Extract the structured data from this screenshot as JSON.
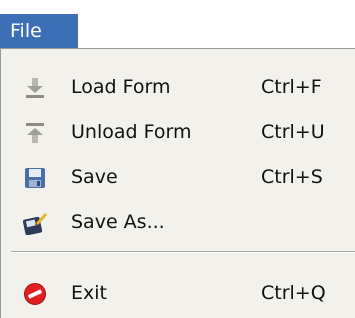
{
  "menu": {
    "title": "File",
    "items": [
      {
        "label": "Load Form",
        "shortcut": "Ctrl+F",
        "icon": "load-icon"
      },
      {
        "label": "Unload Form",
        "shortcut": "Ctrl+U",
        "icon": "unload-icon"
      },
      {
        "label": "Save",
        "shortcut": "Ctrl+S",
        "icon": "save-icon"
      },
      {
        "label": "Save As...",
        "shortcut": "",
        "icon": "save-as-icon"
      },
      {
        "label": "Exit",
        "shortcut": "Ctrl+Q",
        "icon": "exit-icon"
      }
    ]
  },
  "colors": {
    "menu_title_bg": "#3d6fb6",
    "menu_bg": "#f2f1ec",
    "exit_icon": "#e02020"
  }
}
